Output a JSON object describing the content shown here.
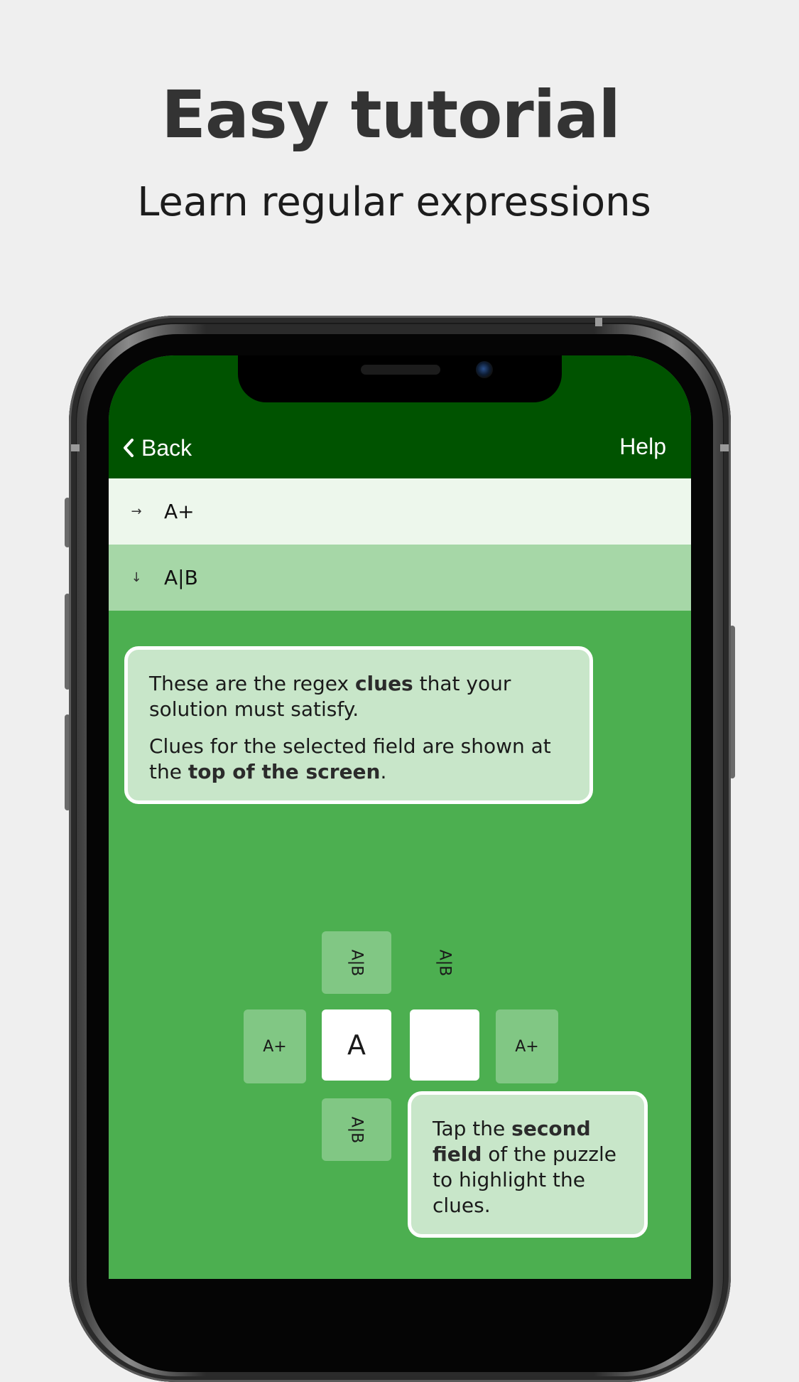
{
  "header": {
    "title": "Easy tutorial",
    "subtitle": "Learn regular expressions"
  },
  "nav": {
    "back_label": "Back",
    "help_label": "Help"
  },
  "clues": {
    "across": {
      "arrow": "→",
      "text": "A+"
    },
    "down": {
      "arrow": "↓",
      "text": "A|B"
    }
  },
  "tip1": {
    "p1_pre": "These are the regex ",
    "p1_bold": "clues",
    "p1_post": " that your solution must satisfy.",
    "p2_pre": "Clues for the selected field are shown at the ",
    "p2_bold": "top of the screen",
    "p2_post": "."
  },
  "puzzle": {
    "col_hints_top": [
      "A|B",
      "A|B"
    ],
    "col_hint_bottom": "A|B",
    "row_hint_left": "A+",
    "row_hint_right": "A+",
    "cells": [
      "A",
      ""
    ]
  },
  "tip2": {
    "pre": "Tap the ",
    "bold": "second field",
    "post": " of the puzzle to highlight the clues."
  },
  "colors": {
    "background": "#efefef",
    "topbar": "#005300",
    "screen": "#4caf50",
    "across_row": "#edf7ec",
    "down_row": "#a6d7a7",
    "tip_bg": "#c8e6c9",
    "hint_cell": "#81c784"
  }
}
